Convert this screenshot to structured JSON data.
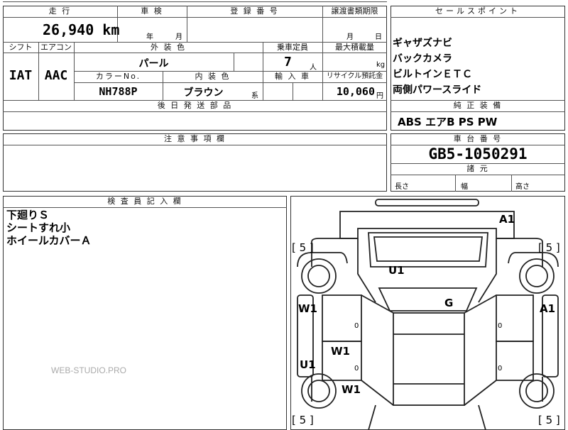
{
  "top": {
    "mileage_hdr": "走 行",
    "mileage_value": "26,940 km",
    "inspection_hdr": "車 検",
    "inspection_year_label": "年",
    "inspection_month_label": "月",
    "reg_number_hdr": "登 録 番 号",
    "transfer_deadline_hdr": "譲渡書類期限",
    "transfer_month_label": "月",
    "transfer_day_label": "日"
  },
  "specs": {
    "shift_hdr": "シフト",
    "aircon_hdr": "エアコン",
    "exterior_color_hdr": "外 装 色",
    "capacity_hdr": "乗車定員",
    "max_load_hdr": "最大積載量",
    "shift_value": "IAT",
    "aircon_value": "AAC",
    "exterior_color_value": "パール",
    "capacity_value": "7",
    "capacity_unit": "人",
    "max_load_unit": "kg",
    "color_no_hdr": "カラーNo.",
    "interior_color_hdr": "内 装 色",
    "import_hdr": "輸 入 車",
    "recycle_hdr": "リサイクル預託金",
    "color_no_value": "NH788P",
    "interior_color_value": "ブラウン",
    "interior_suffix": "系",
    "recycle_value": "10,060",
    "recycle_unit": "円",
    "later_parts_hdr": "後 日 発 送 部 品"
  },
  "sales": {
    "hdr": "セールスポイント",
    "points": [
      "ギャザズナビ",
      "バックカメラ",
      "ビルトインＥＴＣ",
      "両側パワースライド"
    ],
    "equipment_hdr": "純 正 装 備",
    "equipment_value": "ABS エアB PS PW"
  },
  "notes": {
    "hdr": "注 意 事 項 欄"
  },
  "chassis": {
    "hdr": "車 台 番 号",
    "value": "GB5-1050291",
    "dims_hdr": "諸 元",
    "length_label": "長さ",
    "width_label": "幅",
    "height_label": "高さ"
  },
  "inspector": {
    "hdr": "検 査 員 記 入 欄",
    "lines": [
      "下廻りＳ",
      "シートすれ小",
      "ホイールカバーＡ"
    ]
  },
  "diagram": {
    "marks": {
      "a1_top": "A1",
      "a1_right": "A1",
      "u1_center": "U1",
      "g_center": "G",
      "w1_left": "W1",
      "u1_left": "U1",
      "w1_lower": "W1",
      "w1_bottom": "W1",
      "bracket_tl": "[ 5 ]",
      "bracket_tr": "[ 5 ]",
      "bracket_bl": "[ 5 ]",
      "bracket_br": "[ 5 ]",
      "zero_1": "0",
      "zero_2": "0",
      "zero_3": "0",
      "zero_4": "0"
    }
  },
  "watermark": "WEB-STUDIO.PRO"
}
